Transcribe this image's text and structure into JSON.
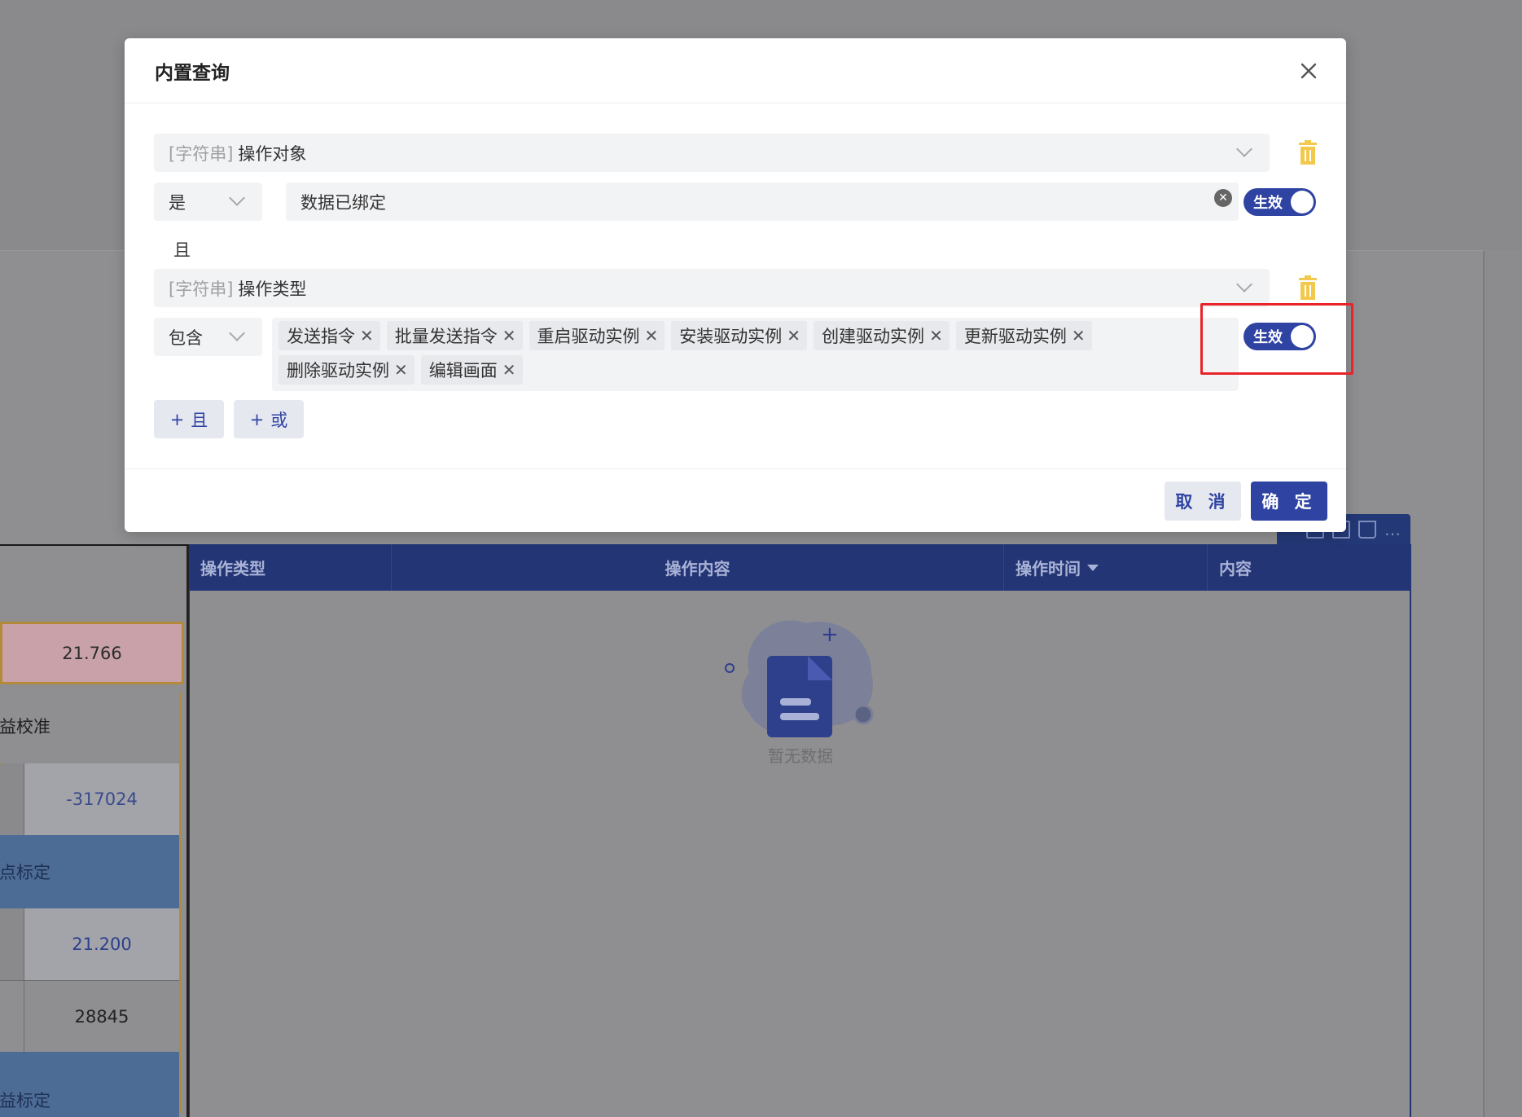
{
  "modal": {
    "title": "内置查询",
    "and_label": "且",
    "conditions": [
      {
        "field_prefix": "[字符串]",
        "field_name": "操作对象",
        "operator": "是",
        "value": "数据已绑定",
        "switch_label": "生效"
      },
      {
        "field_prefix": "[字符串]",
        "field_name": "操作类型",
        "operator": "包含",
        "tags": [
          "发送指令",
          "批量发送指令",
          "重启驱动实例",
          "安装驱动实例",
          "创建驱动实例",
          "更新驱动实例",
          "删除驱动实例",
          "编辑画面"
        ],
        "switch_label": "生效"
      }
    ],
    "add_and": "且",
    "add_or": "或",
    "plus": "+",
    "cancel": "取 消",
    "ok": "确 定"
  },
  "table": {
    "columns": [
      "操作类型",
      "操作内容",
      "操作时间",
      "内容"
    ],
    "empty_text": "暂无数据"
  },
  "left_panel": {
    "value_top": "21.766",
    "gain_calibration": "增益校准",
    "value_1": "-317024",
    "zero_calibration": "零点标定",
    "value_2": "21.200",
    "value_3": "28845",
    "gain_calibration_2": "增益标定"
  },
  "colors": {
    "primary": "#2f43a3",
    "table_header": "#233574",
    "highlight": "#e8242a",
    "trash": "#f2c94c"
  },
  "icons": {
    "close": "close-icon",
    "trash": "trash-icon",
    "chevron": "chevron-down-icon",
    "clear": "clear-icon",
    "tag_remove": "tag-remove-icon"
  }
}
